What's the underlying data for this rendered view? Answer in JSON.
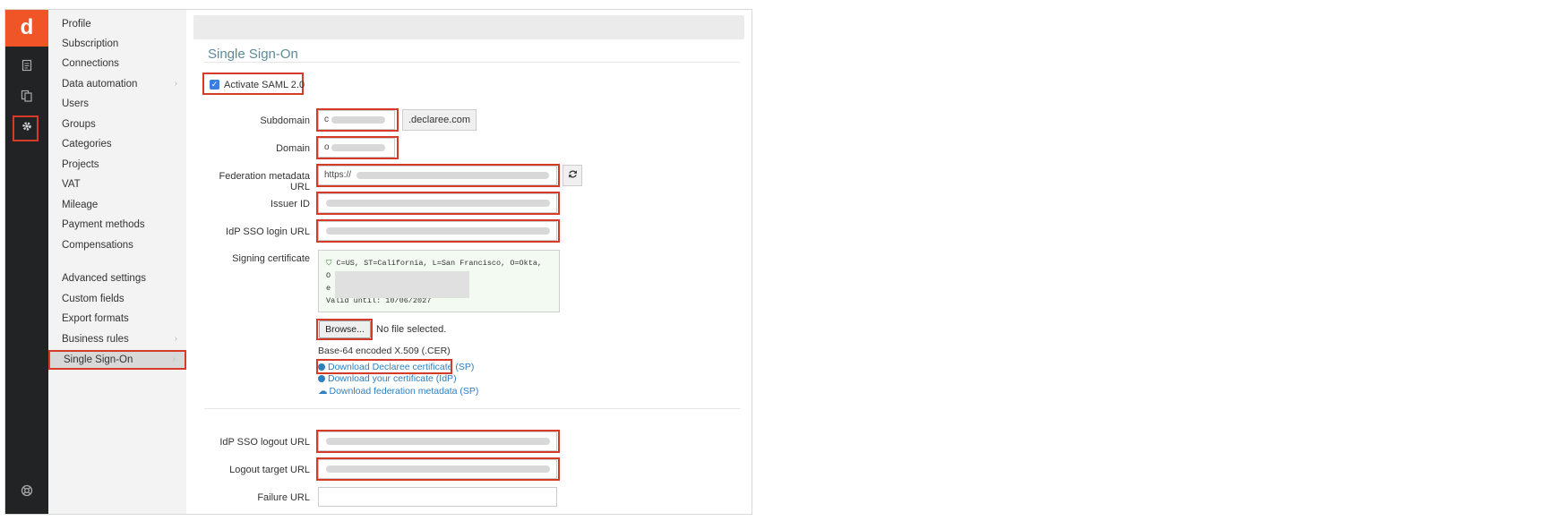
{
  "app": {
    "logo": "d"
  },
  "rail": {
    "icons": [
      {
        "name": "document-icon",
        "glyph": "▤"
      },
      {
        "name": "copy-icon",
        "glyph": "❐"
      },
      {
        "name": "gear-icon",
        "glyph": "⚙"
      },
      {
        "name": "help-icon",
        "glyph": "⊕"
      }
    ]
  },
  "subnav": {
    "items": [
      {
        "label": "Profile"
      },
      {
        "label": "Subscription"
      },
      {
        "label": "Connections"
      },
      {
        "label": "Data automation"
      },
      {
        "label": "Users"
      },
      {
        "label": "Groups"
      },
      {
        "label": "Categories"
      },
      {
        "label": "Projects"
      },
      {
        "label": "VAT"
      },
      {
        "label": "Mileage"
      },
      {
        "label": "Payment methods"
      },
      {
        "label": "Compensations"
      },
      {
        "label": "Advanced settings"
      },
      {
        "label": "Custom fields"
      },
      {
        "label": "Export formats"
      },
      {
        "label": "Business rules"
      },
      {
        "label": "Single Sign-On"
      }
    ]
  },
  "sso": {
    "title": "Single Sign-On",
    "activate_label": "Activate SAML 2.0",
    "subdomain": {
      "label": "Subdomain",
      "value": "c",
      "suffix": ".declaree.com"
    },
    "domain": {
      "label": "Domain",
      "value": "o"
    },
    "federation_metadata_url": {
      "label": "Federation metadata URL",
      "value": "https://"
    },
    "issuer_id": {
      "label": "Issuer ID"
    },
    "idp_sso_login_url": {
      "label": "IdP SSO login URL"
    },
    "signing_certificate": {
      "label": "Signing certificate",
      "line1": "C=US, ST=California, L=San Francisco, O=Okta,",
      "line2": "O",
      "line3": "e",
      "line4": "Valid until: 10/06/2027"
    },
    "browse_label": "Browse...",
    "no_file": "No file selected.",
    "format_note": "Base-64 encoded X.509 (.CER)",
    "links": {
      "download_declaree_cert": "Download Declaree certificate (SP)",
      "download_your_cert": "Download your certificate (IdP)",
      "download_federation_metadata": "Download federation metadata (SP)"
    },
    "idp_sso_logout_url": {
      "label": "IdP SSO logout URL"
    },
    "logout_target_url": {
      "label": "Logout target URL"
    },
    "failure_url": {
      "label": "Failure URL"
    }
  },
  "colors": {
    "brand": "#ef5527",
    "highlight": "#d63b27",
    "link": "#2d7fc1"
  }
}
